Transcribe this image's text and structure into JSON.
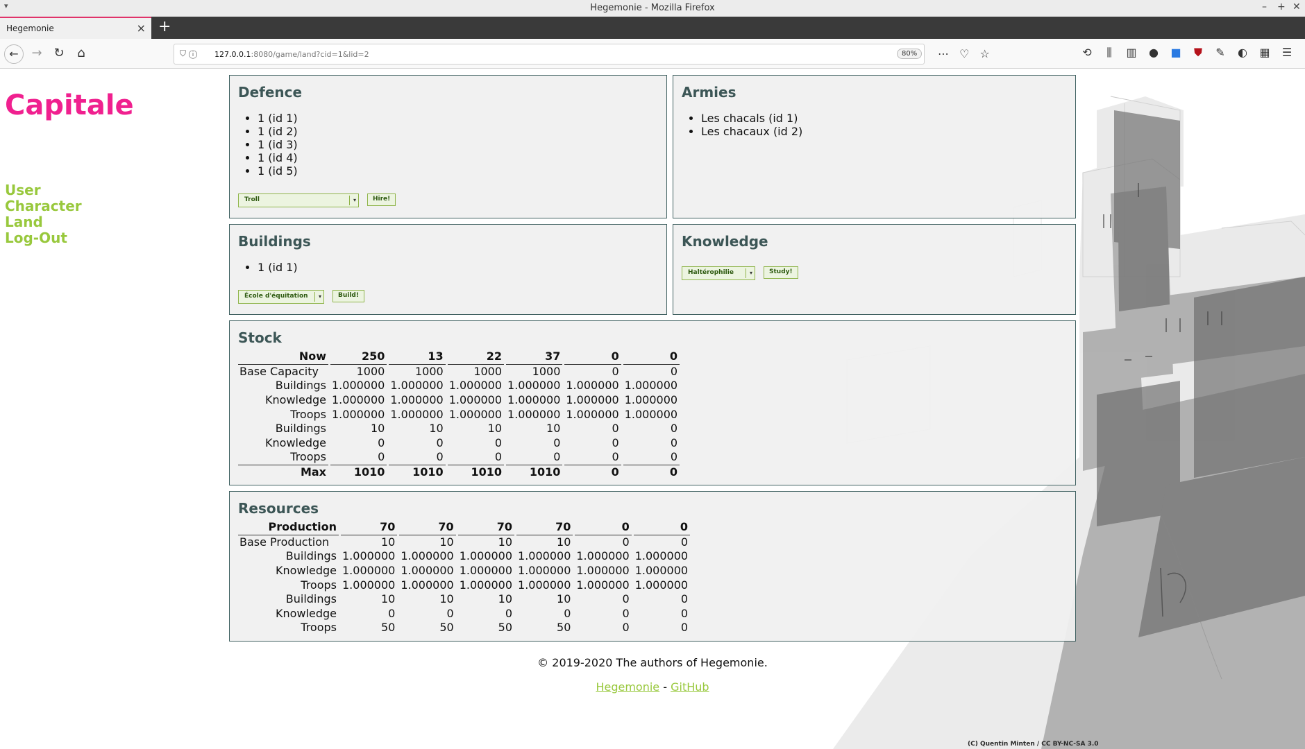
{
  "browser": {
    "window_title": "Hegemonie - Mozilla Firefox",
    "tab_title": "Hegemonie",
    "url_host": "127.0.0.1",
    "url_rest": ":8080/game/land?cid=1&lid=2",
    "zoom": "80%"
  },
  "site": {
    "brand": "Capitale",
    "menu": [
      "User",
      "Character",
      "Land",
      "Log-Out"
    ]
  },
  "defence": {
    "title": "Defence",
    "items": [
      "1 (id 1)",
      "1 (id 2)",
      "1 (id 3)",
      "1 (id 4)",
      "1 (id 5)"
    ],
    "select_value": "Troll",
    "button": "Hire!"
  },
  "armies": {
    "title": "Armies",
    "items": [
      "Les chacals (id 1)",
      "Les chacaux (id 2)"
    ]
  },
  "buildings": {
    "title": "Buildings",
    "items": [
      "1 (id 1)"
    ],
    "select_value": "École d'équitation",
    "button": "Build!"
  },
  "knowledge": {
    "title": "Knowledge",
    "select_value": "Haltérophilie",
    "button": "Study!"
  },
  "stock": {
    "title": "Stock",
    "header": [
      "Now",
      "250",
      "13",
      "22",
      "37",
      "0",
      "0"
    ],
    "rows": [
      [
        "Base Capacity",
        "1000",
        "1000",
        "1000",
        "1000",
        "0",
        "0"
      ],
      [
        "Buildings",
        "1.000000",
        "1.000000",
        "1.000000",
        "1.000000",
        "1.000000",
        "1.000000"
      ],
      [
        "Knowledge",
        "1.000000",
        "1.000000",
        "1.000000",
        "1.000000",
        "1.000000",
        "1.000000"
      ],
      [
        "Troops",
        "1.000000",
        "1.000000",
        "1.000000",
        "1.000000",
        "1.000000",
        "1.000000"
      ],
      [
        "Buildings",
        "10",
        "10",
        "10",
        "10",
        "0",
        "0"
      ],
      [
        "Knowledge",
        "0",
        "0",
        "0",
        "0",
        "0",
        "0"
      ],
      [
        "Troops",
        "0",
        "0",
        "0",
        "0",
        "0",
        "0"
      ]
    ],
    "footer": [
      "Max",
      "1010",
      "1010",
      "1010",
      "1010",
      "0",
      "0"
    ]
  },
  "resources": {
    "title": "Resources",
    "header": [
      "Production",
      "70",
      "70",
      "70",
      "70",
      "0",
      "0"
    ],
    "rows": [
      [
        "Base Production",
        "10",
        "10",
        "10",
        "10",
        "0",
        "0"
      ],
      [
        "Buildings",
        "1.000000",
        "1.000000",
        "1.000000",
        "1.000000",
        "1.000000",
        "1.000000"
      ],
      [
        "Knowledge",
        "1.000000",
        "1.000000",
        "1.000000",
        "1.000000",
        "1.000000",
        "1.000000"
      ],
      [
        "Troops",
        "1.000000",
        "1.000000",
        "1.000000",
        "1.000000",
        "1.000000",
        "1.000000"
      ],
      [
        "Buildings",
        "10",
        "10",
        "10",
        "10",
        "0",
        "0"
      ],
      [
        "Knowledge",
        "0",
        "0",
        "0",
        "0",
        "0",
        "0"
      ],
      [
        "Troops",
        "50",
        "50",
        "50",
        "50",
        "0",
        "0"
      ]
    ]
  },
  "footer": {
    "copyright": "© 2019-2020 The authors of Hegemonie.",
    "link1": "Hegemonie",
    "separator": "-",
    "link2": "GitHub",
    "credit": "(C) Quentin Minten / CC BY-NC-SA 3.0"
  },
  "colors": {
    "brand": "#f0208f",
    "menu": "#98c83c",
    "panel_title": "#3c5656",
    "panel_border": "#3f6060"
  }
}
